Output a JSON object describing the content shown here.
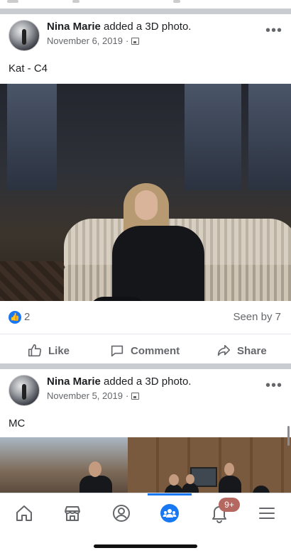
{
  "posts": [
    {
      "author": "Nina Marie",
      "action": "added a 3D photo.",
      "date": "November 6, 2019",
      "date_separator": "·",
      "caption": "Kat - C4",
      "like_count": "2",
      "seen_by": "Seen by 7"
    },
    {
      "author": "Nina Marie",
      "action": "added a 3D photo.",
      "date": "November 5, 2019",
      "date_separator": "·",
      "caption": "MC"
    }
  ],
  "actions": {
    "like": "Like",
    "comment": "Comment",
    "share": "Share"
  },
  "more_glyph": "•••",
  "nav": {
    "items": [
      "home-icon",
      "marketplace-icon",
      "profile-icon",
      "groups-icon",
      "notifications-icon",
      "menu-icon"
    ],
    "active": "groups-icon",
    "notification_badge": "9+"
  },
  "colors": {
    "accent": "#1877f2",
    "badge": "#b5685f",
    "separator": "#c9ccd1"
  }
}
